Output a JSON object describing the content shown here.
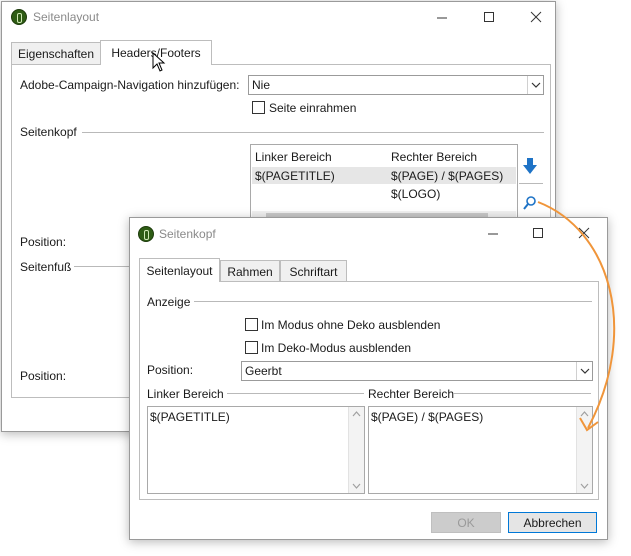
{
  "main_window": {
    "title": "Seitenlayout",
    "tabs": [
      {
        "label": "Eigenschaften",
        "active": false
      },
      {
        "label": "Headers/Footers",
        "active": true
      }
    ],
    "nav_label": "Adobe-Campaign-Navigation hinzufügen:",
    "nav_value": "Nie",
    "frame_checkbox_label": "Seite einrahmen",
    "header_group": "Seitenkopf",
    "header_columns": [
      "Linker Bereich",
      "Rechter Bereich"
    ],
    "header_rows": [
      [
        "$(PAGETITLE)",
        "$(PAGE) / $(PAGES)"
      ],
      [
        "",
        "$(LOGO)"
      ]
    ],
    "position_label_1": "Position:",
    "footer_group": "Seitenfuß",
    "position_label_2": "Position:"
  },
  "dialog": {
    "title": "Seitenkopf",
    "tabs": [
      {
        "label": "Seitenlayout",
        "active": true
      },
      {
        "label": "Rahmen",
        "active": false
      },
      {
        "label": "Schriftart",
        "active": false
      }
    ],
    "display_group": "Anzeige",
    "checkbox_nodeco": "Im Modus ohne Deko ausblenden",
    "checkbox_deco": "Im Deko-Modus ausblenden",
    "position_label": "Position:",
    "position_value": "Geerbt",
    "left_group": "Linker Bereich",
    "left_text": "$(PAGETITLE)",
    "right_group": "Rechter Bereich",
    "right_text": "$(PAGE) / $(PAGES)",
    "ok_label": "OK",
    "cancel_label": "Abbrechen"
  },
  "colors": {
    "accent_arrow": "#f0953a",
    "blue": "#1e73c6",
    "selected_row": "#e6e6e6"
  }
}
